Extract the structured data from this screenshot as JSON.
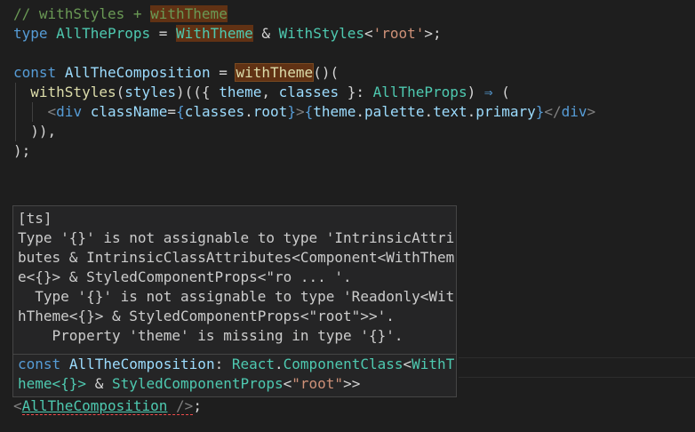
{
  "code": {
    "l1": {
      "comment": "// withStyles + ",
      "hl": "withTheme"
    },
    "l2": {
      "kw": "type",
      "name": "AllTheProps",
      "eq": " = ",
      "t1": "WithTheme",
      "amp": " & ",
      "t2": "WithStyles",
      "lt": "<",
      "str": "'root'",
      "end": ">;"
    },
    "l4": {
      "kw": "const",
      "name": "AllTheComposition",
      "eq": " = ",
      "fn": "withTheme",
      "end": "()("
    },
    "l5": {
      "fn": "withStyles",
      "p1": "(",
      "arg": "styles",
      "p2": ")(({ ",
      "a1": "theme",
      "comma": ", ",
      "a2": "classes",
      "p3": " }: ",
      "type": "AllTheProps",
      "p4": ") ",
      "arrow": "⇒",
      "p5": " ("
    },
    "l6": {
      "lt": "<",
      "tag": "div",
      "sp": " ",
      "attr": "className",
      "eq": "=",
      "ob": "{",
      "v1": "classes",
      "dot1": ".",
      "v2": "root",
      "cb": "}",
      "gt": ">",
      "ob2": "{",
      "e1": "theme",
      "d1": ".",
      "e2": "palette",
      "d2": ".",
      "e3": "text",
      "d3": ".",
      "e4": "primary",
      "cb2": "}",
      "close": "</",
      "tag2": "div",
      "gt2": ">"
    },
    "l7": "  )),",
    "l8": ");",
    "last": {
      "lt": "<",
      "name": "AllTheComposition",
      "end": " />",
      "semi": ";"
    }
  },
  "hover": {
    "message": [
      "[ts]",
      "Type '{}' is not assignable to type 'IntrinsicAttri",
      "butes & IntrinsicClassAttributes<Component<WithThem",
      "e<{}> & StyledComponentProps<\"ro ... '.",
      "  Type '{}' is not assignable to type 'Readonly<Wit",
      "hTheme<{}> & StyledComponentProps<\"root\">>'.",
      "    Property 'theme' is missing in type '{}'."
    ],
    "sig1": {
      "kw": "const",
      "name": "AllTheComposition",
      "colon": ": ",
      "ns": "React",
      "dot": ".",
      "cls": "ComponentClass",
      "lt": "<",
      "t": "WithT"
    },
    "sig2": {
      "t": "heme<{}>",
      "amp": " & ",
      "p": "StyledComponentProps",
      "lt": "<",
      "str": "\"root\"",
      "gt": ">>"
    }
  }
}
